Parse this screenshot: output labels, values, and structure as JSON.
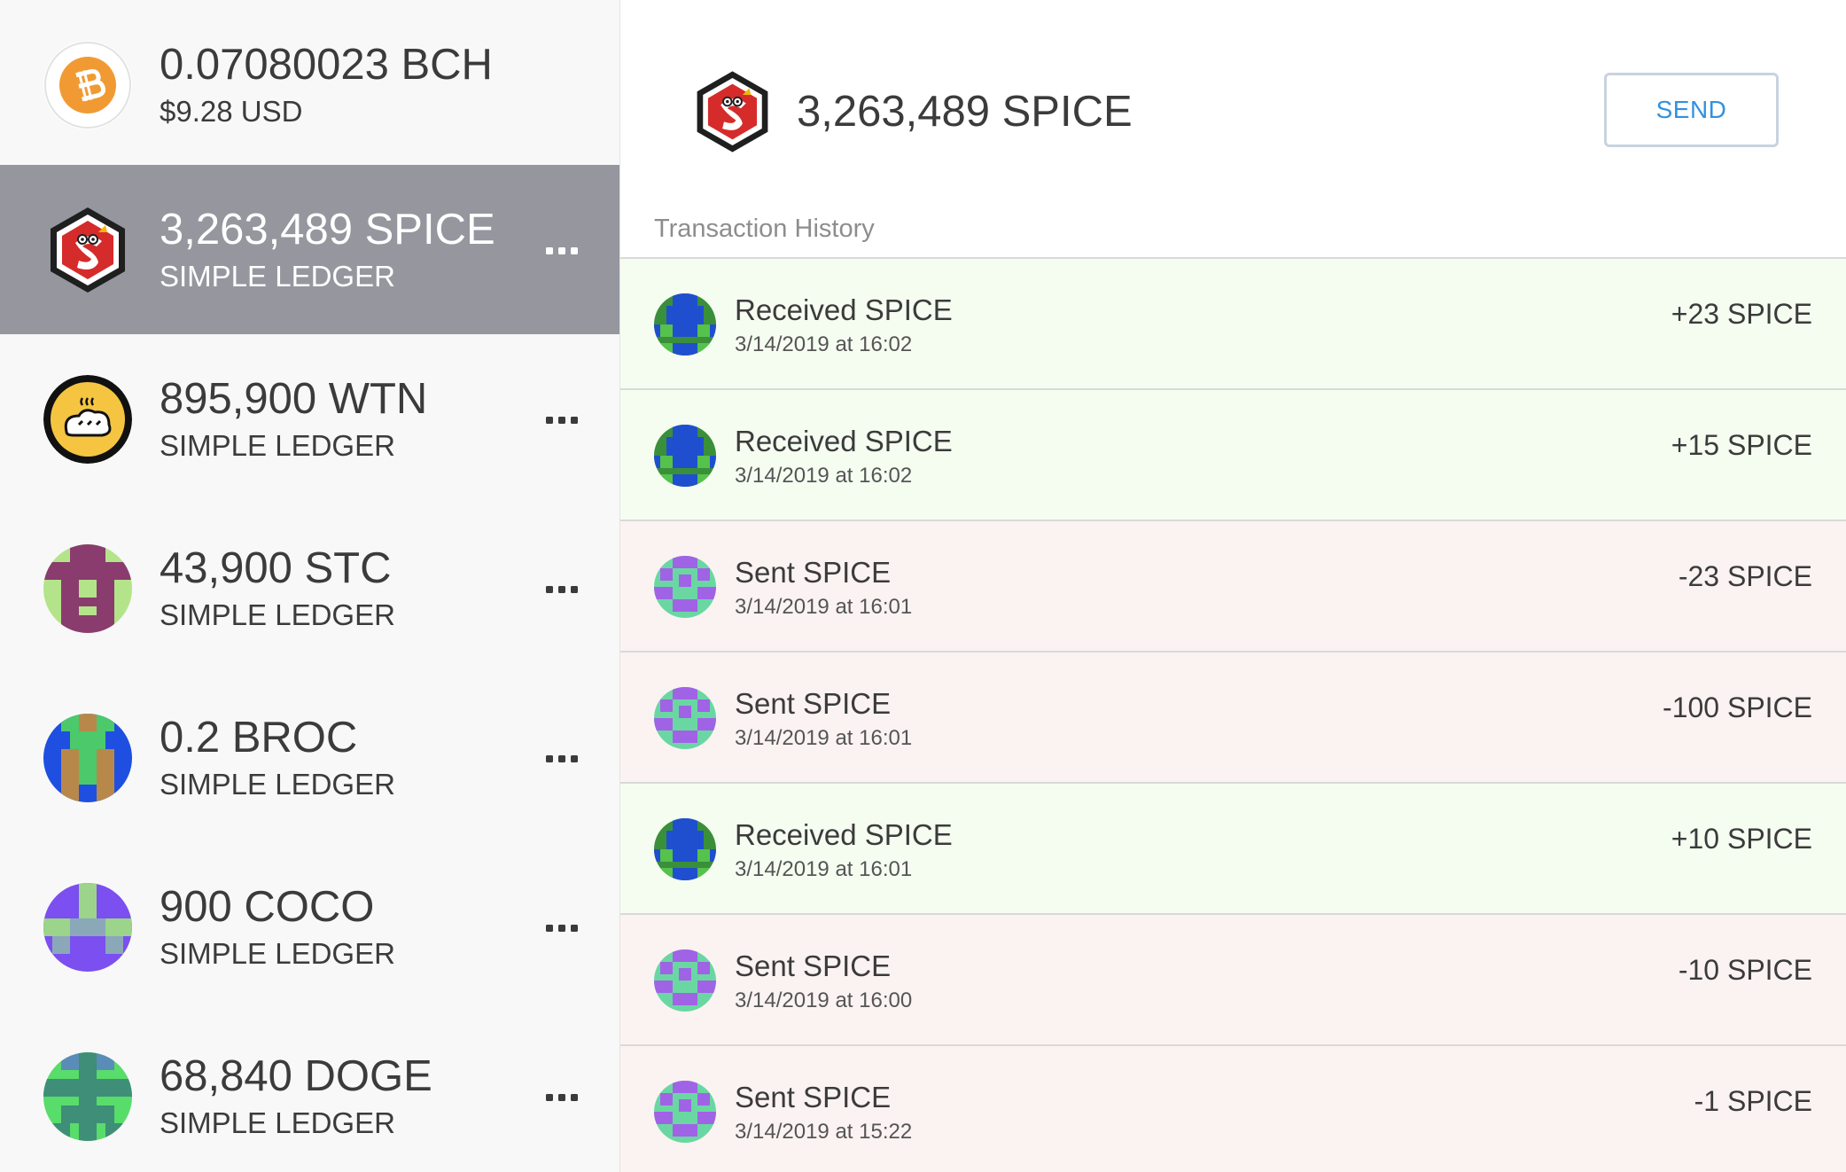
{
  "sidebar": {
    "wallets": [
      {
        "amount": "0.07080023 BCH",
        "subtitle": "$9.28 USD",
        "icon": "bitcoin-cash-icon",
        "selected": false,
        "has_menu": false
      },
      {
        "amount": "3,263,489 SPICE",
        "subtitle": "SIMPLE LEDGER",
        "icon": "spice-token-icon",
        "selected": true,
        "has_menu": true
      },
      {
        "amount": "895,900 WTN",
        "subtitle": "SIMPLE LEDGER",
        "icon": "wtn-bread-icon",
        "selected": false,
        "has_menu": true
      },
      {
        "amount": "43,900 STC",
        "subtitle": "SIMPLE LEDGER",
        "icon": "stc-identicon",
        "selected": false,
        "has_menu": true
      },
      {
        "amount": "0.2 BROC",
        "subtitle": "SIMPLE LEDGER",
        "icon": "broc-identicon",
        "selected": false,
        "has_menu": true
      },
      {
        "amount": "900 COCO",
        "subtitle": "SIMPLE LEDGER",
        "icon": "coco-identicon",
        "selected": false,
        "has_menu": true
      },
      {
        "amount": "68,840 DOGE",
        "subtitle": "SIMPLE LEDGER",
        "icon": "doge-identicon",
        "selected": false,
        "has_menu": true
      }
    ]
  },
  "main": {
    "header": {
      "title": "3,263,489 SPICE",
      "icon": "spice-token-icon"
    },
    "send_label": "SEND",
    "history_label": "Transaction History",
    "transactions": [
      {
        "type": "received",
        "title": "Received SPICE",
        "time": "3/14/2019 at 16:02",
        "amount": "+23 SPICE"
      },
      {
        "type": "received",
        "title": "Received SPICE",
        "time": "3/14/2019 at 16:02",
        "amount": "+15 SPICE"
      },
      {
        "type": "sent",
        "title": "Sent SPICE",
        "time": "3/14/2019 at 16:01",
        "amount": "-23 SPICE"
      },
      {
        "type": "sent",
        "title": "Sent SPICE",
        "time": "3/14/2019 at 16:01",
        "amount": "-100 SPICE"
      },
      {
        "type": "received",
        "title": "Received SPICE",
        "time": "3/14/2019 at 16:01",
        "amount": "+10 SPICE"
      },
      {
        "type": "sent",
        "title": "Sent SPICE",
        "time": "3/14/2019 at 16:00",
        "amount": "-10 SPICE"
      },
      {
        "type": "sent",
        "title": "Sent SPICE",
        "time": "3/14/2019 at 15:22",
        "amount": "-1 SPICE"
      }
    ]
  },
  "colors": {
    "selected_row": "#95969e",
    "received_bg": "#f5fdf1",
    "sent_bg": "#fbf3f2",
    "accent": "#3391e0",
    "bch_orange": "#f19a33"
  }
}
